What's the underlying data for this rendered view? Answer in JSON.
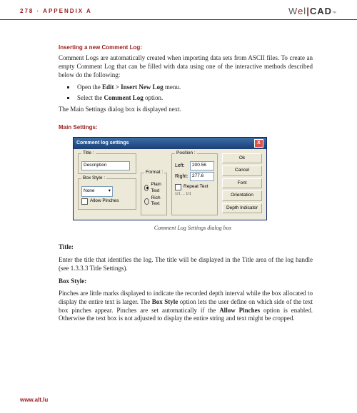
{
  "header": {
    "page_appendix": "278 · APPENDIX A",
    "brand": {
      "w": "W",
      "e": "e",
      "l": "l",
      "bar": "|",
      "c": "C",
      "a": "A",
      "d": "D",
      "tm": "™"
    }
  },
  "sec": {
    "inserting": "Inserting a new Comment Log:",
    "p1": "Comment Logs are automatically created when importing data sets from ASCII files. To create an empty Comment Log that can be filled with data using one of the interactive methods described below do the following:",
    "li1a": "Open the ",
    "li1b": "Edit > Insert New Log",
    "li1c": " menu.",
    "li2a": "Select the ",
    "li2b": "Comment Log",
    "li2c": " option.",
    "p2": "The Main Settings dialog box is displayed next."
  },
  "mainset": {
    "heading": "Main Settings:",
    "caption": "Comment Log Settings dialog box"
  },
  "dlg": {
    "title": "Comment log settings",
    "close": "X",
    "grp_title": "Title :",
    "title_val": "Description",
    "grp_box": "Box Style :",
    "box_val": "None",
    "allow_pinches": "Allow Pinches",
    "grp_format": "Format :",
    "r_plain": "Plain Text",
    "r_rich": "Rich Text",
    "grp_pos": "Position :",
    "lbl_left": "Left:",
    "lbl_right": "Right:",
    "val_left": "200.56",
    "val_right": "277.6",
    "repeat": "Repeat Text",
    "unit_pair": "1/1 ... 1/1",
    "btn_ok": "Ok",
    "btn_cancel": "Cancel",
    "btn_font": "Font",
    "btn_orient": "Orientation",
    "btn_depth": "Depth Indicator"
  },
  "after": {
    "title_h": "Title:",
    "title_p": "Enter the title that identifies the log. The title will be displayed in the Title area of the log handle (see 1.3.3.3 Title Settings).",
    "box_h": "Box Style:",
    "box_p1a": "Pinches are little marks displayed to indicate the recorded depth interval while the box allocated to display the entire text is larger. The ",
    "box_p1b": "Box Style",
    "box_p1c": " option lets the user define on which side of the text box pinches appear. Pinches are set automatically if the ",
    "box_p1d": "Allow Pinches",
    "box_p1e": " option is enabled. Otherwise the text box is not adjusted to display the entire string and text might be cropped."
  },
  "footer": {
    "url": "www.alt.lu"
  }
}
